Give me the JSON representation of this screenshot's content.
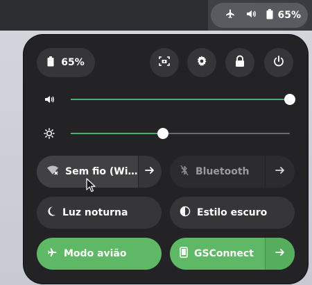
{
  "status_bar": {
    "icons": [
      "airplane-icon",
      "volume-icon",
      "battery-icon"
    ],
    "battery_text": "65%"
  },
  "quick_settings": {
    "battery_text": "65%",
    "top_buttons": [
      "screenshot-icon",
      "settings-icon",
      "lock-icon",
      "power-icon"
    ],
    "volume_level": 1.0,
    "brightness_level": 0.42,
    "tiles": {
      "wifi": "Sem fio (Wi…",
      "bluetooth": "Bluetooth",
      "night_light": "Luz noturna",
      "dark_style": "Estilo escuro",
      "airplane": "Modo avião",
      "gsconnect": "GSConnect"
    }
  },
  "colors": {
    "accent": "#5fb866",
    "panel_bg": "#232325",
    "tile_bg": "#363638"
  }
}
